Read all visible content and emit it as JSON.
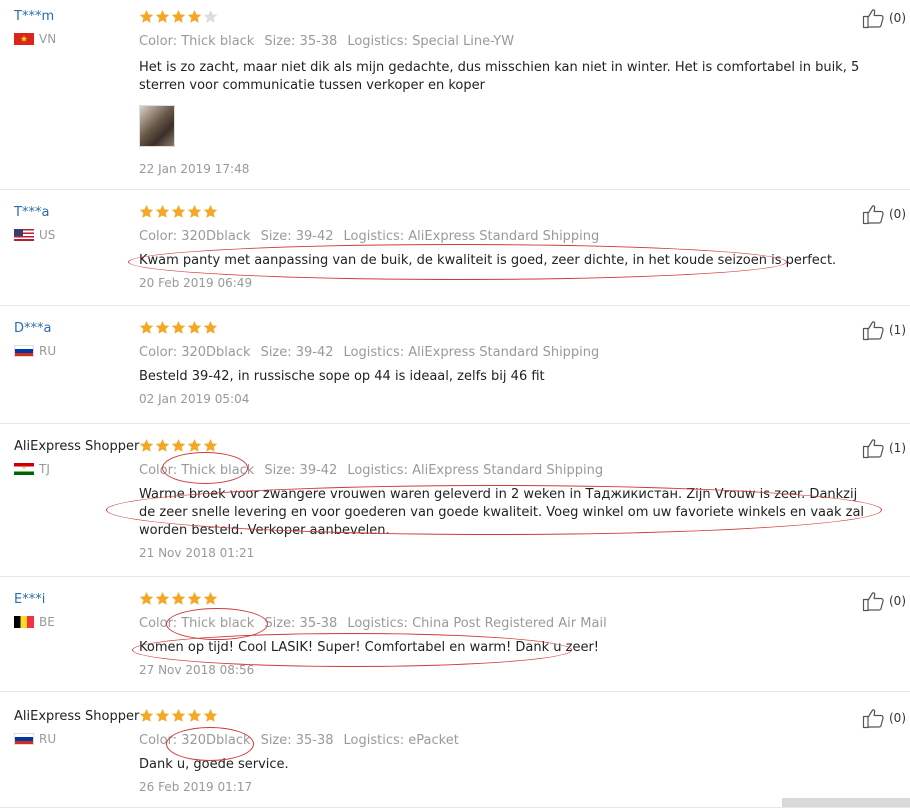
{
  "colors": {
    "star": "#f5a623",
    "link": "#2b6dad",
    "annotation": "#cf3b3b"
  },
  "reviews": [
    {
      "user": "T***m",
      "country": "VN",
      "flag": "vn",
      "stars": 4,
      "color": "Color: Thick black",
      "size": "Size: 35-38",
      "logistics": "Logistics: Special Line-YW",
      "text": "Het is zo zacht, maar niet dik als mijn gedachte, dus misschien kan niet in winter. Het is comfortabel in buik, 5 sterren voor communicatie tussen verkoper en koper",
      "has_image": true,
      "date": "22 Jan 2019 17:48",
      "helpful": "(0)"
    },
    {
      "user": "T***a",
      "country": "US",
      "flag": "us",
      "stars": 5,
      "color": "Color: 320Dblack",
      "size": "Size: 39-42",
      "logistics": "Logistics: AliExpress Standard Shipping",
      "text": "Kwam panty met aanpassing van de buik, de kwaliteit is goed, zeer dichte, in het koude seizoen is perfect.",
      "date": "20 Feb 2019 06:49",
      "helpful": "(0)"
    },
    {
      "user": "D***a",
      "country": "RU",
      "flag": "ru",
      "stars": 5,
      "color": "Color: 320Dblack",
      "size": "Size: 39-42",
      "logistics": "Logistics: AliExpress Standard Shipping",
      "text": "Besteld 39-42, in russische sope op 44 is ideaal, zelfs bij 46 fit",
      "date": "02 Jan 2019 05:04",
      "helpful": "(1)"
    },
    {
      "user": "AliExpress Shopper",
      "country": "TJ",
      "flag": "tj",
      "stars": 5,
      "color": "Color: Thick black",
      "size": "Size: 39-42",
      "logistics": "Logistics: AliExpress Standard Shipping",
      "text": "Warme broek voor zwangere vrouwen waren geleverd in 2 weken in Таджикистан. Zijn Vrouw is zeer. Dankzij de zeer snelle levering en voor goederen van goede kwaliteit. Voeg winkel om uw favoriete winkels en vaak zal worden besteld. Verkoper aanbevelen.",
      "date": "21 Nov 2018 01:21",
      "helpful": "(1)"
    },
    {
      "user": "E***i",
      "country": "BE",
      "flag": "be",
      "stars": 5,
      "color": "Color: Thick black",
      "size": "Size: 35-38",
      "logistics": "Logistics: China Post Registered Air Mail",
      "text": "Komen op tijd! Cool LASIK! Super! Comfortabel en warm! Dank u zeer!",
      "date": "27 Nov 2018 08:56",
      "helpful": "(0)"
    },
    {
      "user": "AliExpress Shopper",
      "country": "RU",
      "flag": "ru",
      "stars": 5,
      "color": "Color: 320Dblack",
      "size": "Size: 35-38",
      "logistics": "Logistics: ePacket",
      "text": "Dank u, goede service.",
      "date": "26 Feb 2019 01:17",
      "helpful": "(0)"
    }
  ]
}
